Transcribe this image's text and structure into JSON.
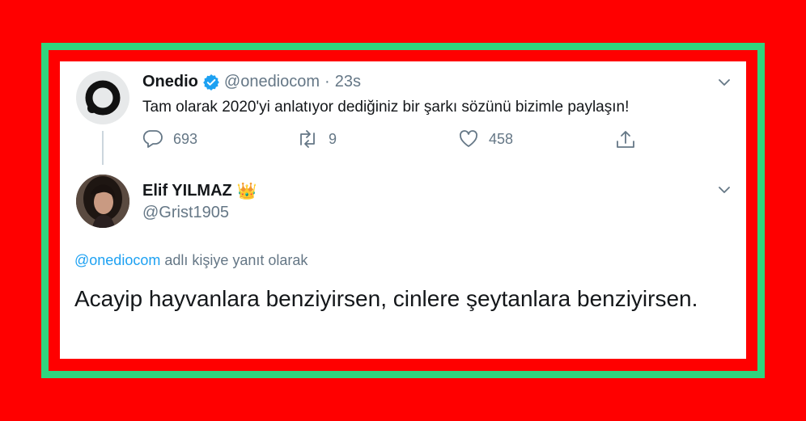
{
  "tweet1": {
    "author_name": "Onedio",
    "handle": "@onediocom",
    "separator": "·",
    "time": "23s",
    "text": "Tam olarak 2020'yi anlatıyor dediğiniz bir şarkı sözünü bizimle paylaşın!",
    "replies": "693",
    "retweets": "9",
    "likes": "458",
    "verified_color": "#1da1f2"
  },
  "tweet2": {
    "author_name": "Elif YILMAZ",
    "badge_icon": "crown-emoji",
    "badge": "👑",
    "handle": "@Grist1905",
    "reply_to_user": "@onediocom",
    "reply_to_suffix": " adlı kişiye yanıt olarak",
    "text": "Acayip hayvanlara benziyirsen, cinlere şeytanlara benziyirsen."
  },
  "colors": {
    "background": "#ff0000",
    "frame": "#2fd57e",
    "link": "#1da1f2",
    "muted": "#657786"
  }
}
